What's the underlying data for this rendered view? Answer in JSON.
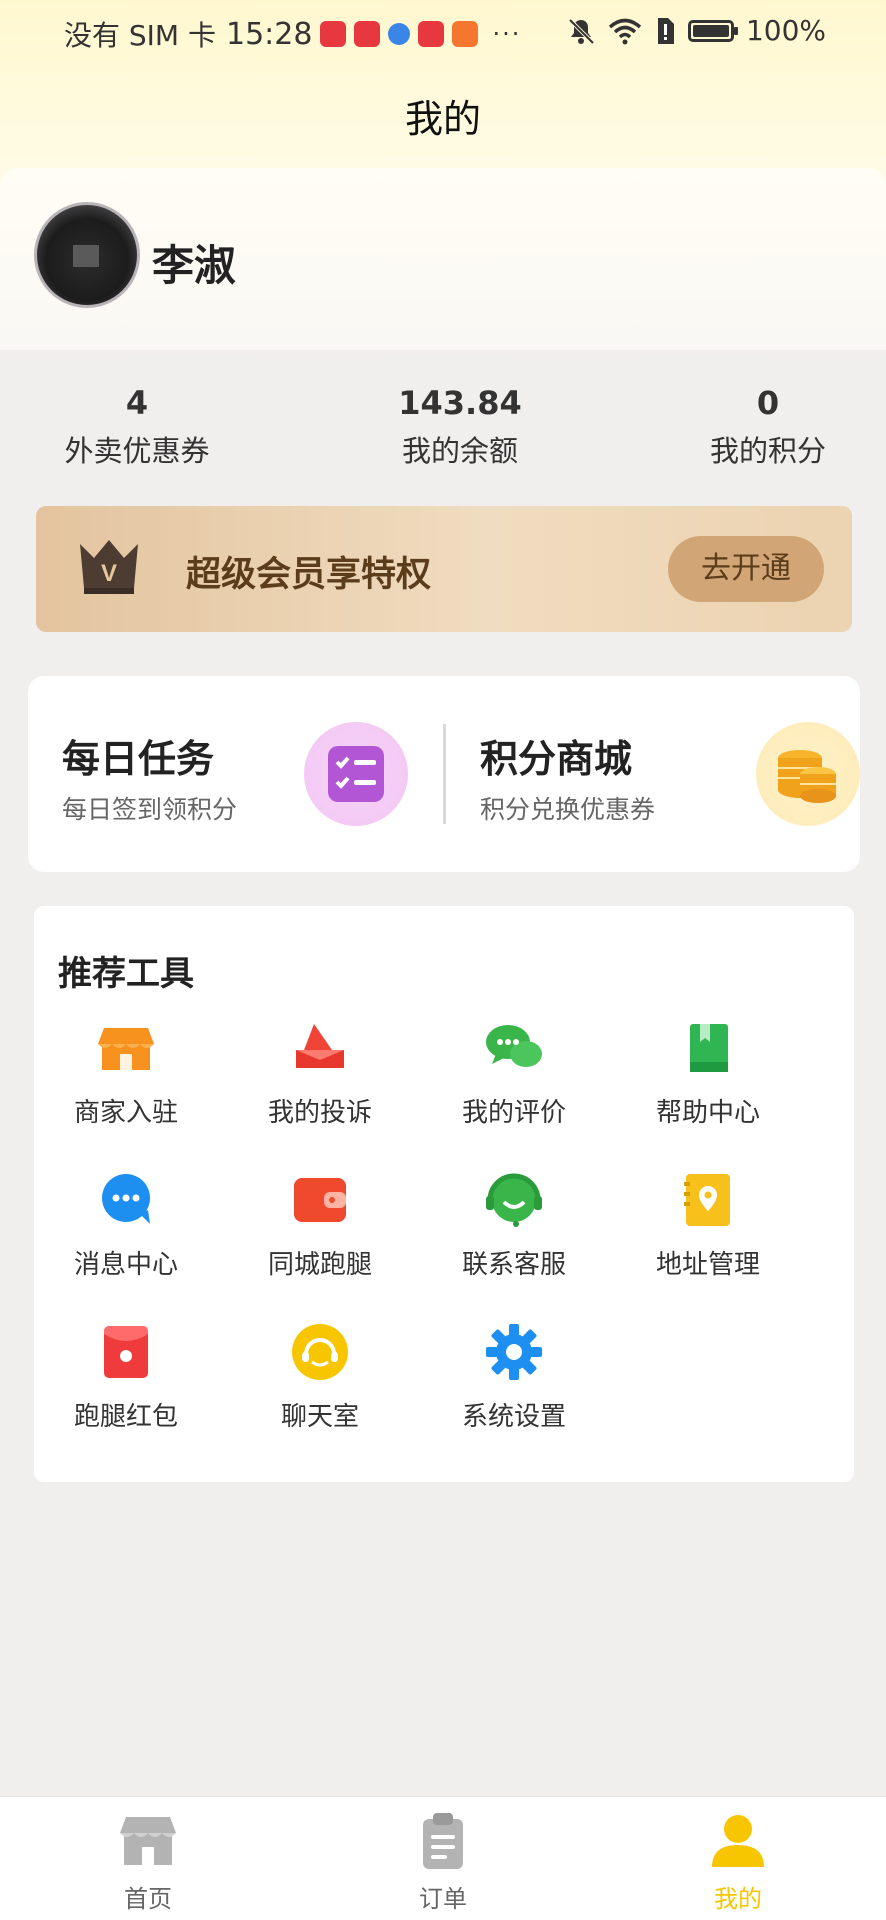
{
  "status_bar": {
    "carrier": "没有 SIM 卡",
    "time": "15:28",
    "more": "···",
    "battery": "100%"
  },
  "header": {
    "title": "我的"
  },
  "profile": {
    "name": "李淑"
  },
  "stats": [
    {
      "value": "4",
      "label": "外卖优惠券"
    },
    {
      "value": "143.84",
      "label": "我的余额"
    },
    {
      "value": "0",
      "label": "我的积分"
    }
  ],
  "vip": {
    "badge": "V",
    "text": "超级会员享特权",
    "button": "去开通"
  },
  "tasks": {
    "daily": {
      "title": "每日任务",
      "subtitle": "每日签到领积分"
    },
    "mall": {
      "title": "积分商城",
      "subtitle": "积分兑换优惠券"
    }
  },
  "tools": {
    "title": "推荐工具",
    "items": [
      {
        "label": "商家入驻",
        "icon": "store-icon"
      },
      {
        "label": "我的投诉",
        "icon": "complaint-icon"
      },
      {
        "label": "我的评价",
        "icon": "chat-bubbles-icon"
      },
      {
        "label": "帮助中心",
        "icon": "book-icon"
      },
      {
        "label": "消息中心",
        "icon": "message-icon"
      },
      {
        "label": "同城跑腿",
        "icon": "wallet-icon"
      },
      {
        "label": "联系客服",
        "icon": "headset-icon"
      },
      {
        "label": "地址管理",
        "icon": "location-pin-icon"
      },
      {
        "label": "跑腿红包",
        "icon": "red-envelope-icon"
      },
      {
        "label": "聊天室",
        "icon": "chatroom-icon"
      },
      {
        "label": "系统设置",
        "icon": "gear-icon"
      }
    ]
  },
  "nav": {
    "items": [
      {
        "label": "首页",
        "icon": "home-store-icon",
        "active": false
      },
      {
        "label": "订单",
        "icon": "clipboard-icon",
        "active": false
      },
      {
        "label": "我的",
        "icon": "person-icon",
        "active": true
      }
    ],
    "active_color": "#f7c600",
    "inactive_color": "#b3b3b3"
  }
}
